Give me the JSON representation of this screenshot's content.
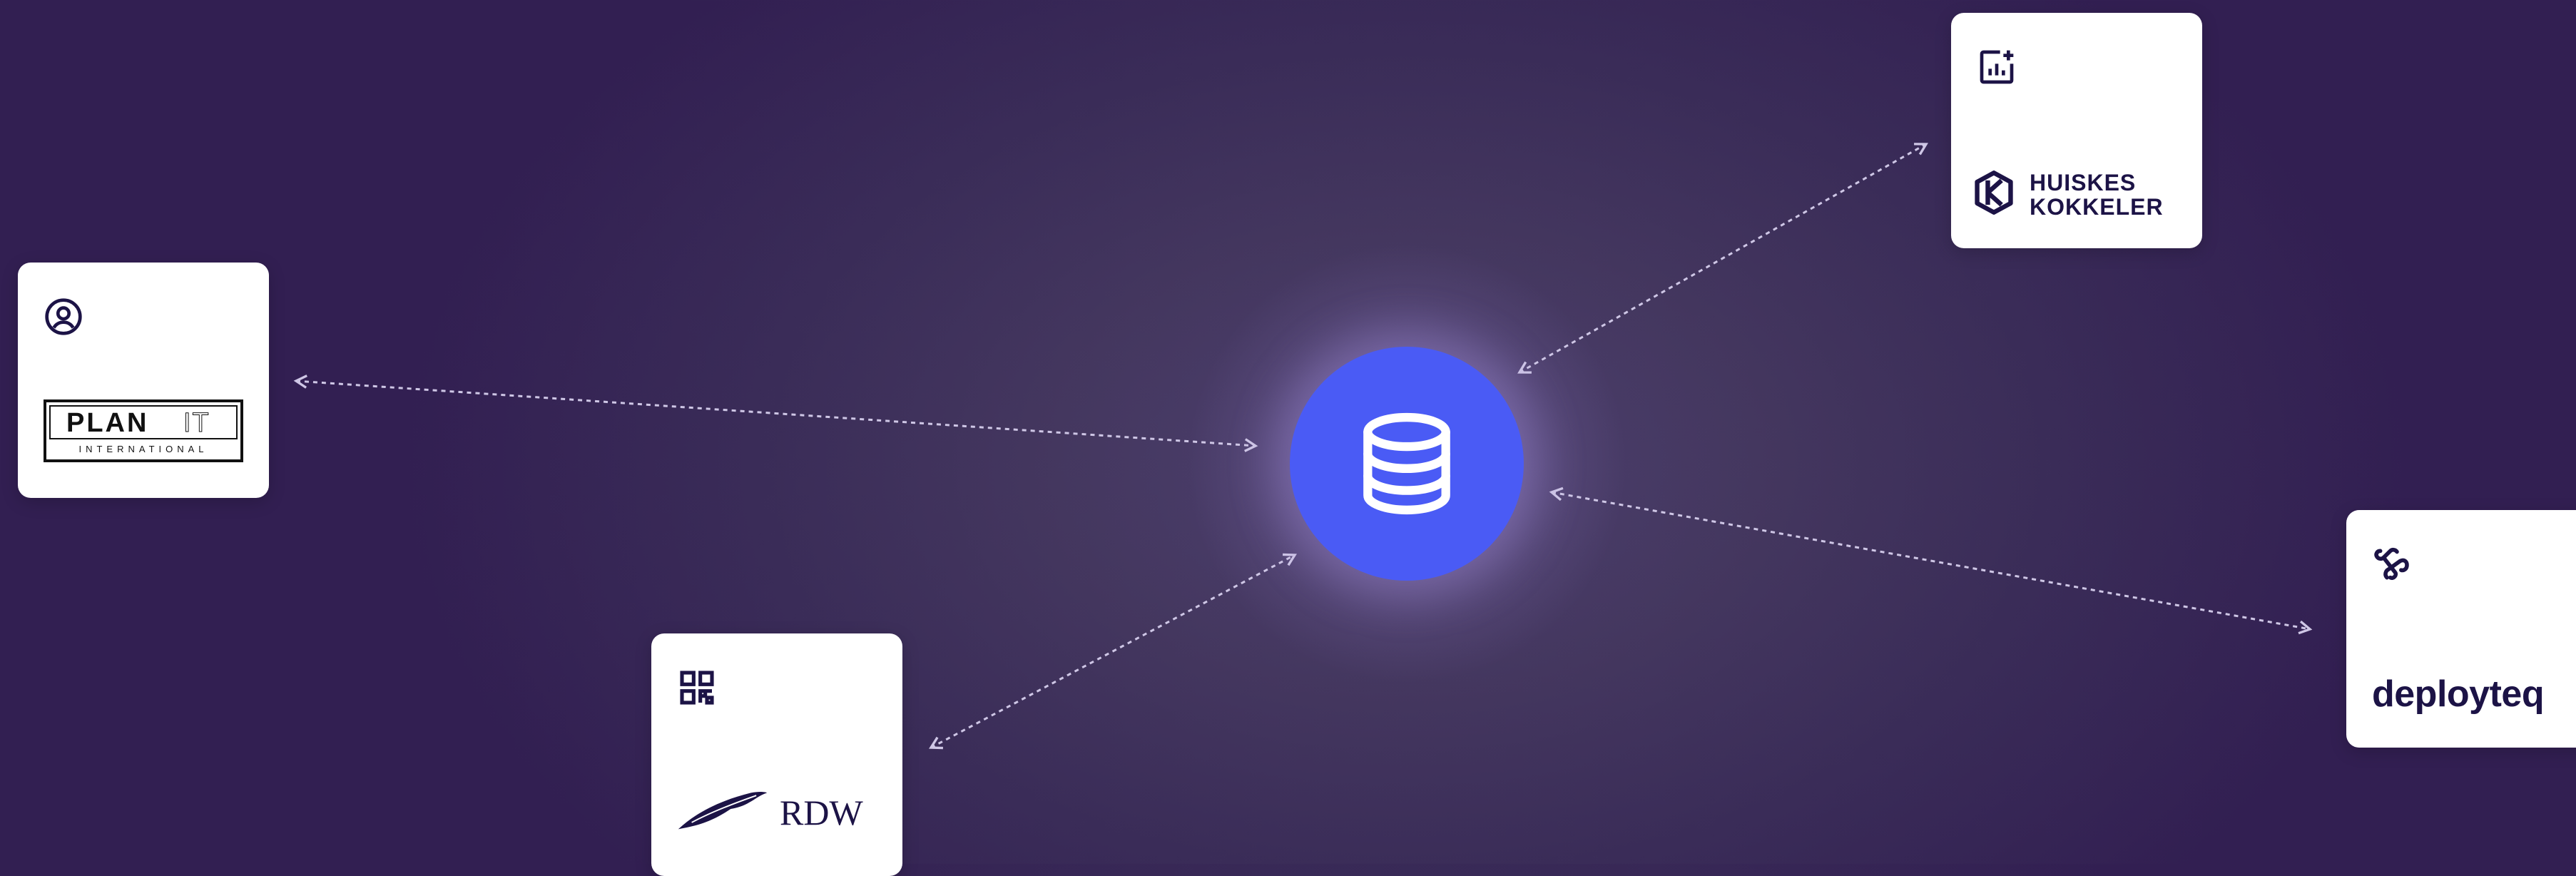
{
  "hub": {
    "icon": "database-icon",
    "color": "#4a5bf5"
  },
  "colors": {
    "card_bg": "#ffffff",
    "logo_ink": "#1c1346",
    "arrow": "#cfc7e6"
  },
  "cards": {
    "plan_it": {
      "icon": "user-circle-icon",
      "logo_line1": "PLAN",
      "logo_line1b": "IT",
      "logo_line2": "INTERNATIONAL"
    },
    "rdw": {
      "icon": "qr-code-icon",
      "logo_text": "RDW"
    },
    "huiskes": {
      "icon": "chart-plus-icon",
      "logo_line1": "HUISKES",
      "logo_line2": "KOKKELER"
    },
    "deployteq": {
      "icon": "link-icon",
      "logo_text": "deployteq"
    }
  }
}
